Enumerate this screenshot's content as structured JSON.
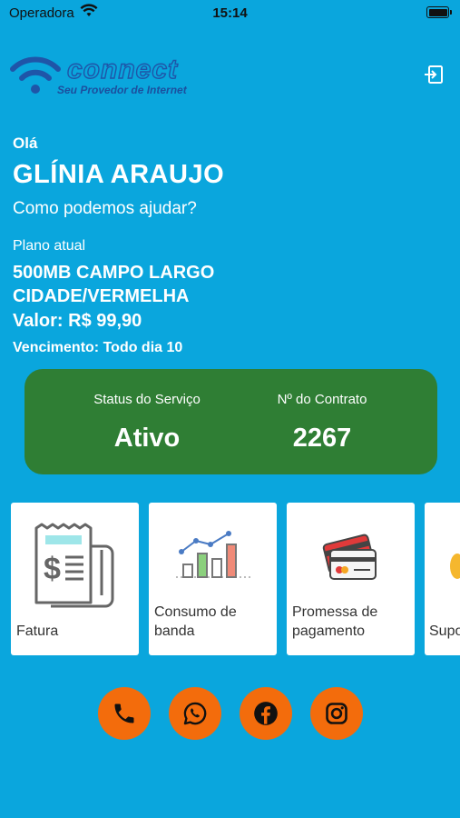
{
  "status_bar": {
    "carrier": "Operadora",
    "time": "15:14"
  },
  "brand": {
    "name": "connect",
    "tagline": "Seu Provedor de Internet"
  },
  "header": {
    "logout_icon": "logout-icon"
  },
  "greeting": {
    "hello": "Olá",
    "user_name": "GLÍNIA ARAUJO",
    "prompt": "Como podemos ajudar?"
  },
  "plan": {
    "label": "Plano atual",
    "name": "500MB CAMPO LARGO CIDADE/VERMELHA",
    "value": "Valor: R$ 99,90",
    "due": "Vencimento: Todo dia 10"
  },
  "service": {
    "status_label": "Status do Serviço",
    "status_value": "Ativo",
    "contract_label": "Nº do Contrato",
    "contract_value": "2267"
  },
  "tiles": [
    {
      "label": "Fatura",
      "icon": "invoice-icon"
    },
    {
      "label": "Consumo de banda",
      "icon": "bandwidth-chart-icon"
    },
    {
      "label": "Promessa de pagamento",
      "icon": "credit-card-icon"
    },
    {
      "label": "Suporte",
      "icon": "support-icon"
    }
  ],
  "social": [
    {
      "icon": "phone-icon"
    },
    {
      "icon": "whatsapp-icon"
    },
    {
      "icon": "facebook-icon"
    },
    {
      "icon": "instagram-icon"
    }
  ],
  "colors": {
    "background": "#0aa6dd",
    "status_card": "#2f7e34",
    "action_button": "#f36c0c"
  }
}
